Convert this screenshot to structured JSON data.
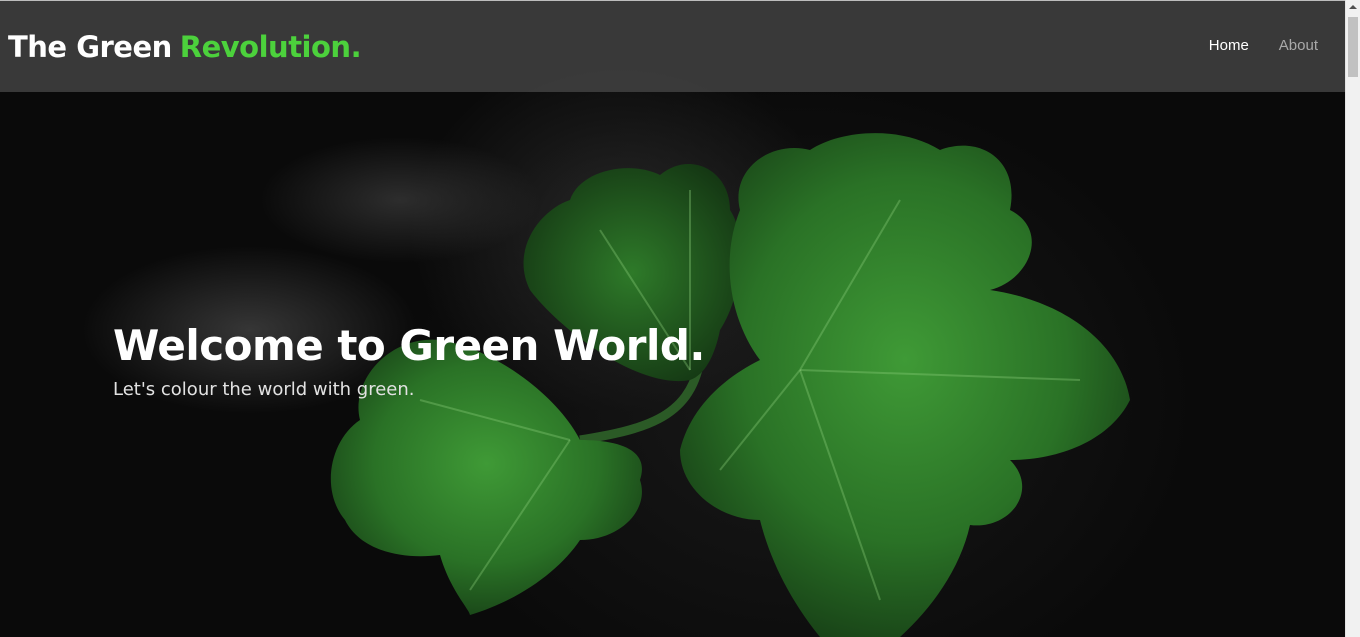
{
  "header": {
    "brand_main": "The Green",
    "brand_accent": "Revolution."
  },
  "nav": {
    "items": [
      {
        "label": "Home",
        "active": true
      },
      {
        "label": "About",
        "active": false
      }
    ]
  },
  "hero": {
    "title": "Welcome to Green World.",
    "subtitle": "Let's colour the world with green."
  },
  "colors": {
    "accent": "#4cd13c",
    "navbar_bg": "#464646",
    "leaf_green": "#2f7a2a",
    "background": "#0b0b0b"
  },
  "icons": {
    "hero_image": "green-leaf-plant-image"
  }
}
